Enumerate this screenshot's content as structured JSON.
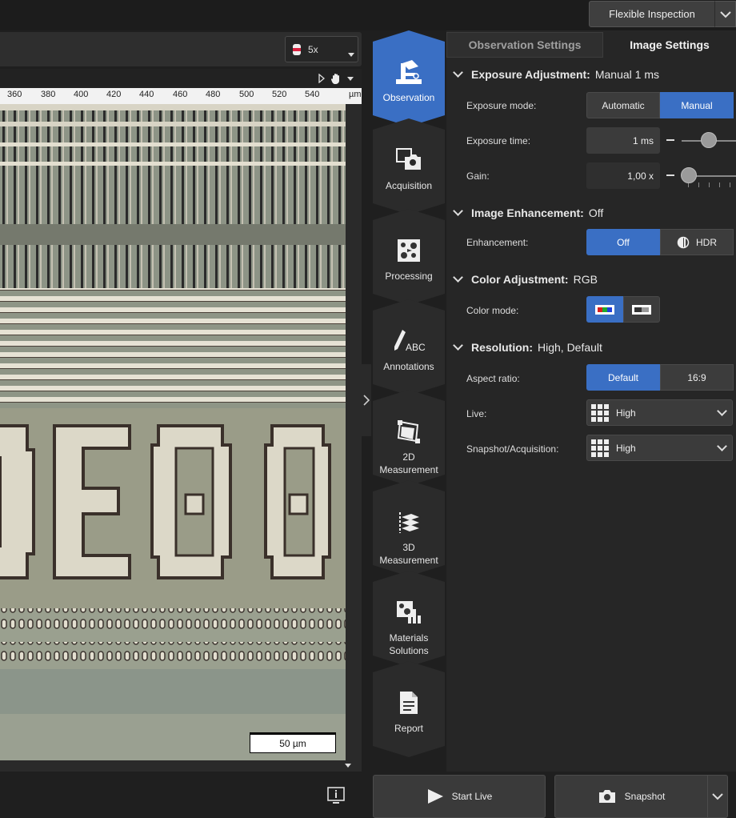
{
  "topbar": {
    "mode_label": "Flexible Inspection"
  },
  "viewer": {
    "magnification": "5x",
    "ruler_labels": [
      "360",
      "380",
      "400",
      "420",
      "440",
      "460",
      "480",
      "500",
      "520",
      "540",
      "µm"
    ],
    "scale_bar": "50 µm"
  },
  "nav": {
    "items": [
      {
        "label": "Observation",
        "icon": "microscope-icon",
        "active": true
      },
      {
        "label": "Acquisition",
        "icon": "camera-frame-icon",
        "active": false
      },
      {
        "label": "Processing",
        "icon": "processing-icon",
        "active": false
      },
      {
        "label": "Annotations",
        "icon": "pencil-abc-icon",
        "icon_text": "ABC",
        "active": false
      },
      {
        "label": "2D Measurement",
        "icon": "measure-2d-icon",
        "active": false
      },
      {
        "label": "3D Measurement",
        "icon": "measure-3d-icon",
        "active": false
      },
      {
        "label": "Materials Solutions",
        "icon": "materials-icon",
        "active": false
      },
      {
        "label": "Report",
        "icon": "document-icon",
        "active": false
      }
    ]
  },
  "tabs": {
    "observation": "Observation Settings",
    "image": "Image Settings"
  },
  "exposure": {
    "title": "Exposure Adjustment:",
    "summary": "Manual 1 ms",
    "mode_label": "Exposure mode:",
    "mode_options": [
      "Automatic",
      "Manual"
    ],
    "mode_selected": "Manual",
    "time_label": "Exposure time:",
    "time_value": "1 ms",
    "gain_label": "Gain:",
    "gain_value": "1,00 x"
  },
  "enhancement": {
    "title": "Image Enhancement:",
    "summary": "Off",
    "label": "Enhancement:",
    "options": [
      "Off",
      "HDR"
    ],
    "selected": "Off"
  },
  "color": {
    "title": "Color Adjustment:",
    "summary": "RGB",
    "label": "Color mode:",
    "options": [
      "rgb-color-icon",
      "grayscale-icon"
    ],
    "selected": "rgb-color-icon"
  },
  "resolution": {
    "title": "Resolution:",
    "summary": "High, Default",
    "aspect_label": "Aspect ratio:",
    "aspect_options": [
      "Default",
      "16:9"
    ],
    "aspect_selected": "Default",
    "live_label": "Live:",
    "live_value": "High",
    "snapshot_label": "Snapshot/Acquisition:",
    "snapshot_value": "High"
  },
  "actions": {
    "start_live": "Start Live",
    "snapshot": "Snapshot"
  },
  "colors": {
    "accent": "#3a6fc4",
    "panel": "#262626",
    "background": "#1f1f1f"
  }
}
